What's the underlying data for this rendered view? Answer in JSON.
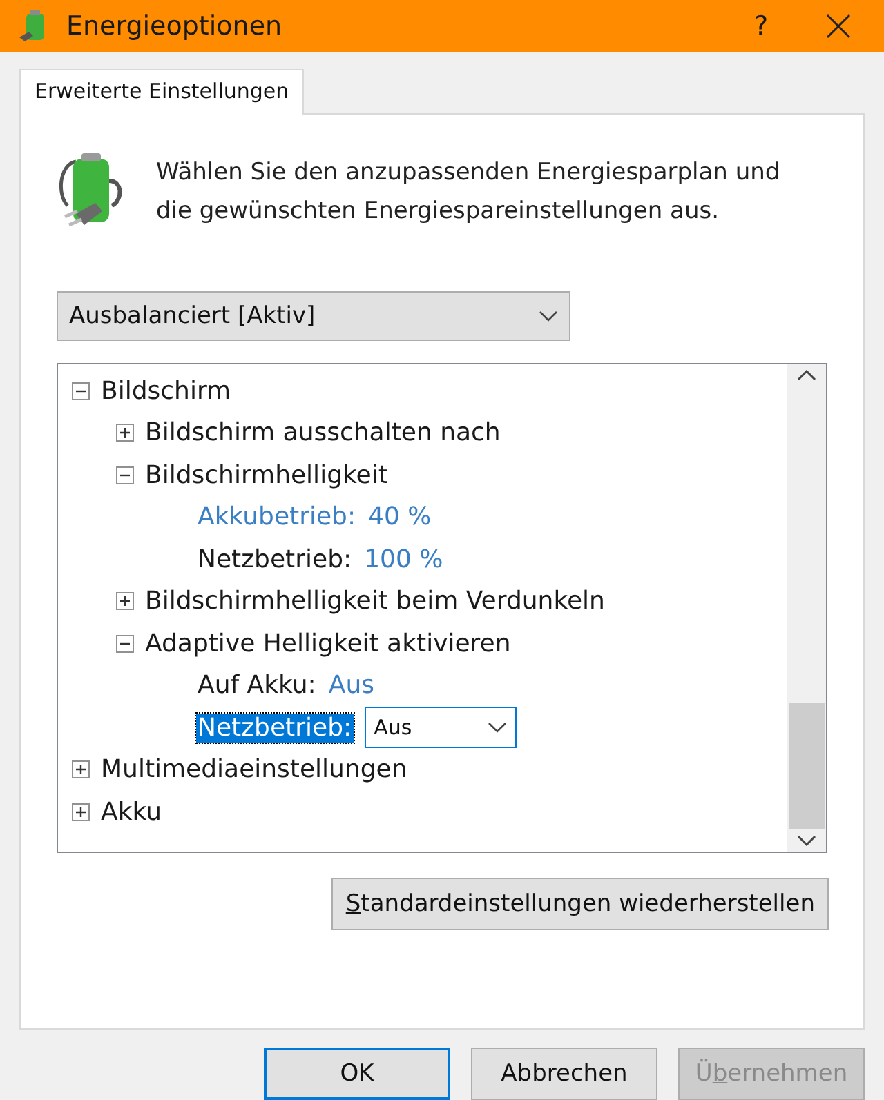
{
  "window": {
    "title": "Energieoptionen",
    "help": "?"
  },
  "tabs": [
    {
      "label": "Erweiterte Einstellungen",
      "selected": true
    }
  ],
  "intro": "Wählen Sie den anzupassenden Energiesparplan und die gewünschten Energiespareinstellungen aus.",
  "plan": {
    "value": "Ausbalanciert [Aktiv]"
  },
  "tree": [
    {
      "label": "Bildschirm",
      "expanded": true,
      "children": [
        {
          "label": "Bildschirm ausschalten nach",
          "expanded": false
        },
        {
          "label": "Bildschirmhelligkeit",
          "expanded": true,
          "settings": [
            {
              "kind": "value",
              "label": "Akkubetrieb:",
              "value": "40 %",
              "selected": false,
              "link_label": true
            },
            {
              "kind": "value",
              "label": "Netzbetrieb:",
              "value": "100 %",
              "selected": false,
              "link_label": false
            }
          ]
        },
        {
          "label": "Bildschirmhelligkeit beim Verdunkeln",
          "expanded": false
        },
        {
          "label": "Adaptive Helligkeit aktivieren",
          "expanded": true,
          "settings": [
            {
              "kind": "value",
              "label": "Auf Akku:",
              "value": "Aus",
              "selected": false,
              "link_label": false
            },
            {
              "kind": "dropdown",
              "label": "Netzbetrieb:",
              "value": "Aus",
              "selected": true,
              "link_label": false
            }
          ]
        }
      ]
    },
    {
      "label": "Multimediaeinstellungen",
      "expanded": false
    },
    {
      "label": "Akku",
      "expanded": false
    }
  ],
  "restore_button": {
    "label": [
      {
        "text": "S",
        "underlined": true
      },
      {
        "text": "tandardeinstellungen wiederherstellen",
        "underlined": false
      }
    ],
    "disabled": false
  },
  "buttons": [
    {
      "label": [
        {
          "text": "OK",
          "underlined": false
        }
      ],
      "default": true,
      "disabled": false
    },
    {
      "label": [
        {
          "text": "Abbrechen",
          "underlined": false
        }
      ],
      "default": false,
      "disabled": false
    },
    {
      "label": [
        {
          "text": "Ü",
          "underlined": false
        },
        {
          "text": "b",
          "underlined": true
        },
        {
          "text": "ernehmen",
          "underlined": false
        }
      ],
      "default": false,
      "disabled": true
    }
  ]
}
